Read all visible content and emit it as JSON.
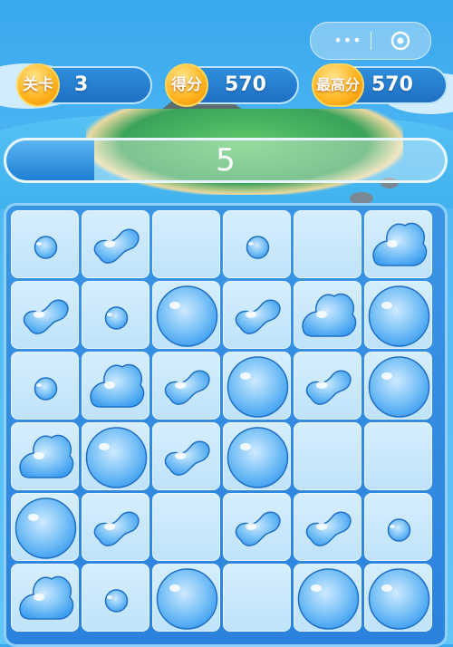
{
  "hud": {
    "level_label": "关卡",
    "level_value": "3",
    "score_label": "得分",
    "score_value": "570",
    "best_label": "最高分",
    "best_value": "570"
  },
  "capsule": {
    "more_glyph": "•••",
    "more_icon": "more-icon",
    "close_icon": "target-close-icon"
  },
  "progress": {
    "value_text": "5",
    "fill_fraction": 0.2
  },
  "board": {
    "rows": [
      [
        "tiny",
        "peanut",
        "empty",
        "tiny",
        "empty",
        "blob"
      ],
      [
        "peanut",
        "tiny",
        "large",
        "peanut",
        "blob",
        "large"
      ],
      [
        "tiny",
        "blob",
        "peanut",
        "large",
        "peanut",
        "large"
      ],
      [
        "blob",
        "large",
        "peanut",
        "large",
        "empty",
        "empty"
      ],
      [
        "large",
        "peanut",
        "empty",
        "peanut",
        "peanut",
        "tiny"
      ],
      [
        "blob",
        "tiny",
        "large",
        "empty",
        "large",
        "large"
      ]
    ]
  },
  "colors": {
    "accent": "#1f6fc4",
    "badge": "#ffb21c",
    "drop_main": "#3b9cf0",
    "drop_light": "#cfeaff"
  }
}
